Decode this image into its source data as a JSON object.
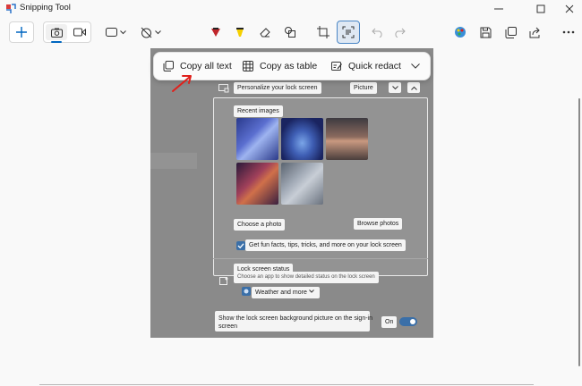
{
  "window": {
    "title": "Snipping Tool",
    "controls": [
      "minimize",
      "maximize",
      "close"
    ]
  },
  "toolbar": {
    "new_icon": "plus-icon",
    "modes": [
      "camera-icon",
      "video-icon"
    ],
    "shape_icon": "rectangle-snip-icon",
    "delay_icon": "no-timer-icon",
    "tools": [
      "ballpoint-pen-icon",
      "highlighter-icon",
      "eraser-icon",
      "shapes-icon",
      "crop-icon",
      "text-actions-icon",
      "undo-icon",
      "redo-icon"
    ],
    "right": [
      "edit-in-paint-icon",
      "save-icon",
      "copy-icon",
      "share-icon",
      "more-icon"
    ]
  },
  "text_actions": {
    "copy_all": "Copy all text",
    "copy_table": "Copy as table",
    "quick_redact": "Quick redact"
  },
  "snip": {
    "personalize": "Personalize your lock screen",
    "picture": "Picture",
    "recent_images": "Recent images",
    "choose_photo": "Choose a photo",
    "browse_photos": "Browse photos",
    "fun_facts": "Get fun facts, tips, tricks, and more on your lock screen",
    "lock_status": "Lock screen status",
    "lock_status_desc": "Choose an app to show detailed status on the lock screen",
    "weather": "Weather and more",
    "signin_bg_line1": "Show the lock screen background picture on the sign-in",
    "signin_bg_line2": "screen",
    "on": "On"
  },
  "colors": {
    "accent": "#0067c0",
    "annotation_arrow": "#e0201b",
    "canvas": "#f9f9f9",
    "screenshot_overlay": "#8a8a8a"
  }
}
